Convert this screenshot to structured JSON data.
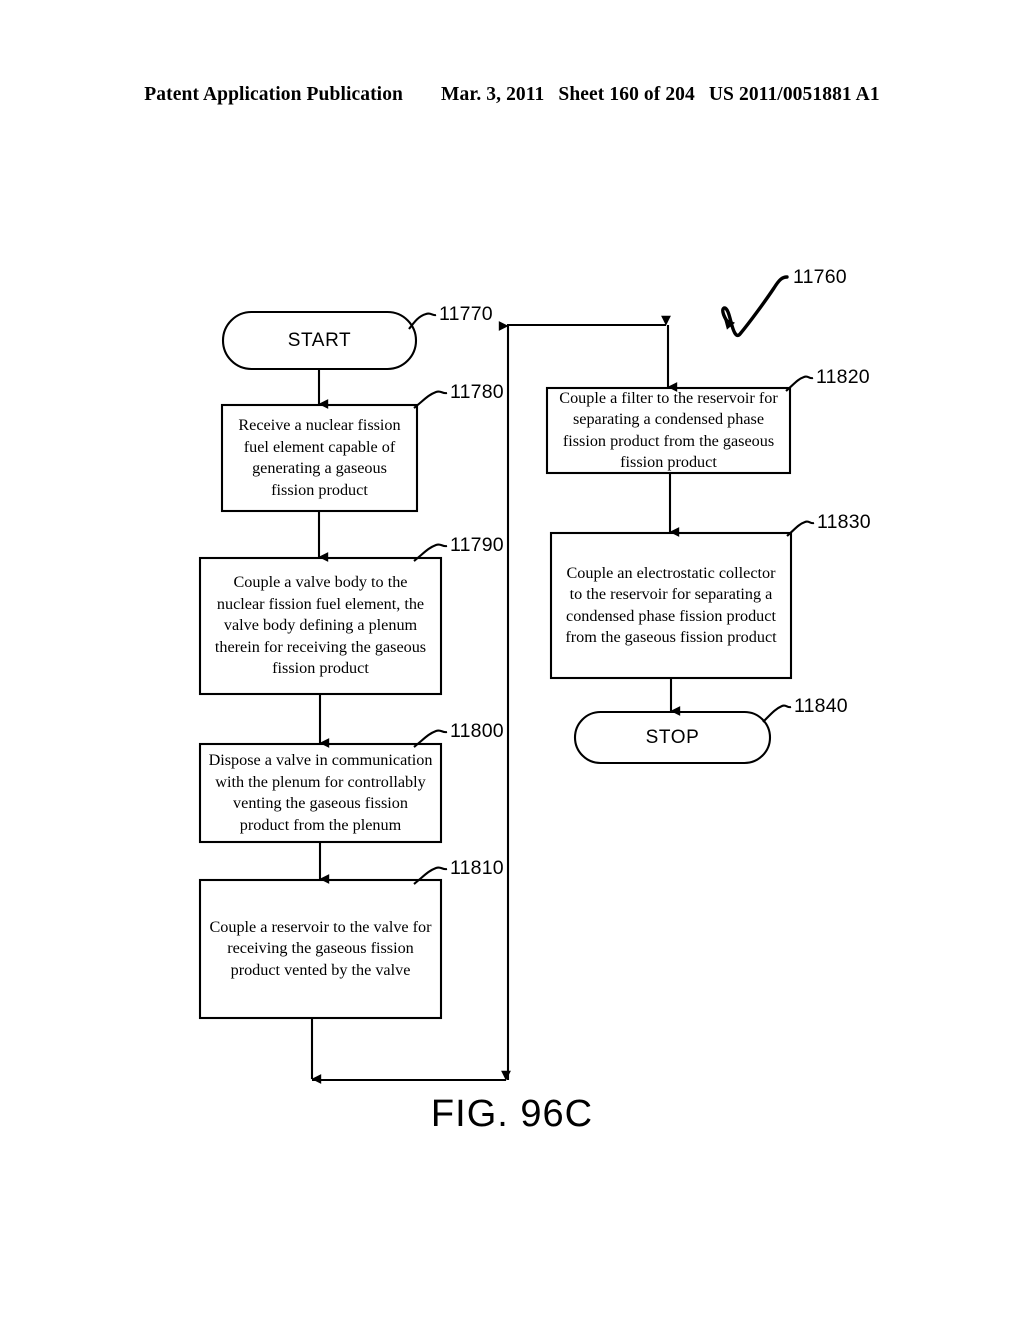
{
  "header": {
    "publication": "Patent Application Publication",
    "date": "Mar. 3, 2011",
    "sheet": "Sheet 160 of 204",
    "patent_number": "US 2011/0051881 A1"
  },
  "figure": {
    "caption": "FIG. 96C",
    "diagram_label": "11760",
    "colors": {
      "stroke": "#000000",
      "fill": "#ffffff",
      "text": "#000000"
    },
    "nodes": [
      {
        "id": "start",
        "ref": "11770",
        "shape": "terminal",
        "text": "START"
      },
      {
        "id": "receive-fuel-element",
        "ref": "11780",
        "shape": "process",
        "text": "Receive a nuclear fission fuel element capable of generating a gaseous fission product"
      },
      {
        "id": "couple-valve-body",
        "ref": "11790",
        "shape": "process",
        "text": "Couple a valve body to the nuclear fission fuel element, the valve body defining a plenum therein for receiving the gaseous fission product"
      },
      {
        "id": "dispose-valve",
        "ref": "11800",
        "shape": "process",
        "text": "Dispose a valve in communication with the plenum for controllably venting the gaseous fission product from the plenum"
      },
      {
        "id": "couple-reservoir",
        "ref": "11810",
        "shape": "process",
        "text": "Couple a reservoir to the valve for receiving the gaseous fission product vented by the valve"
      },
      {
        "id": "couple-filter",
        "ref": "11820",
        "shape": "process",
        "text": "Couple a filter to the reservoir for separating a condensed phase fission product from the gaseous fission product"
      },
      {
        "id": "couple-electrostatic-collector",
        "ref": "11830",
        "shape": "process",
        "text": "Couple an electrostatic collector to the reservoir for separating a condensed phase fission product from the gaseous fission product"
      },
      {
        "id": "stop",
        "ref": "11840",
        "shape": "terminal",
        "text": "STOP"
      }
    ]
  }
}
